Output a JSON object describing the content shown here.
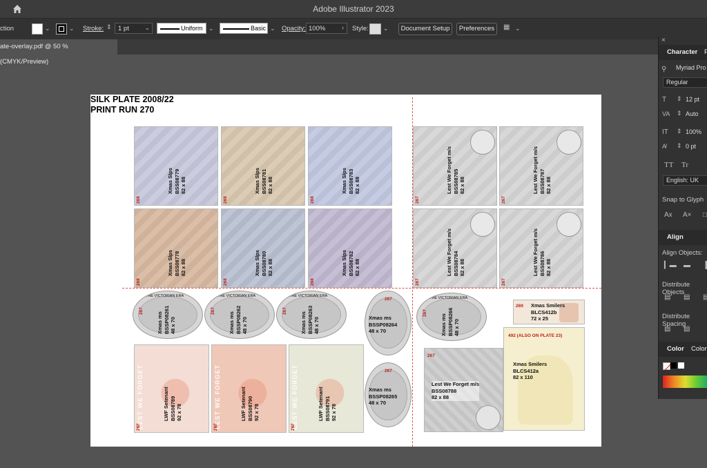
{
  "app": {
    "title": "Adobe Illustrator 2023"
  },
  "controlbar": {
    "selection_label": "ction",
    "stroke_label": "Stroke:",
    "stroke_value": "1 pt",
    "uniform_label": "Uniform",
    "basic_label": "Basic",
    "opacity_label": "Opacity:",
    "opacity_value": "100%",
    "style_label": "Style:",
    "document_setup": "Document Setup",
    "preferences": "Preferences"
  },
  "document_tab": {
    "label": "ate-overlay.pdf @ 50 % (CMYK/Preview)"
  },
  "artboard": {
    "title_line1": "SILK PLATE 2008/22",
    "title_line2": "PRINT RUN 270",
    "xmas_slips": [
      {
        "line1": "Xmas Slps",
        "line2": "BSS08779",
        "line3": "82 x 88",
        "num": "268"
      },
      {
        "line1": "Xmas Slps",
        "line2": "BSS08781",
        "line3": "82 x 88",
        "num": "268"
      },
      {
        "line1": "Xmas Slps",
        "line2": "BSS08783",
        "line3": "82 x 88",
        "num": "268"
      },
      {
        "line1": "Xmas Slps",
        "line2": "BSS08778",
        "line3": "82 x 88",
        "num": "268"
      },
      {
        "line1": "Xmas Slps",
        "line2": "BSS08780",
        "line3": "82 x 88",
        "num": "268"
      },
      {
        "line1": "Xmas Slps",
        "line2": "BSS08782",
        "line3": "82 x 88",
        "num": "268"
      }
    ],
    "lest_we_forget": [
      {
        "line1": "Lest We Forget m/s",
        "line2": "BSS08785",
        "line3": "82 x 88",
        "num": "267"
      },
      {
        "line1": "Lest We Forget m/s",
        "line2": "BSS08787",
        "line3": "82 x 88",
        "num": "267"
      },
      {
        "line1": "Lest We Forget m/s",
        "line2": "BSS08784",
        "line3": "82 x 88",
        "num": "267"
      },
      {
        "line1": "Lest We Forget m/s",
        "line2": "BSS08786",
        "line3": "82 x 88",
        "num": "267"
      }
    ],
    "ovals": [
      {
        "line1": "Xmas ms",
        "line2": "BSSP08261",
        "line3": "48 x 70",
        "num": "267",
        "caption": "THE VICTORIAN ERA"
      },
      {
        "line1": "Xmas ms",
        "line2": "BSSP08262",
        "line3": "48 x 70",
        "num": "267",
        "caption": "THE VICTORIAN ERA"
      },
      {
        "line1": "Xmas ms",
        "line2": "BSSP08263",
        "line3": "48 x 70",
        "num": "267",
        "caption": "THE VICTORIAN ERA"
      },
      {
        "line1": "Xmas ms",
        "line2": "BSSP08266",
        "line3": "48 x 70",
        "num": "267",
        "caption": "THE VICTORIAN ERA"
      }
    ],
    "upright_ovals": [
      {
        "line1": "Xmas ms",
        "line2": "BSSP08264",
        "line3": "48 x 70",
        "num": "267"
      },
      {
        "line1": "Xmas ms",
        "line2": "BSSP08265",
        "line3": "48 x 70",
        "num": "267"
      }
    ],
    "lwf_setenant": [
      {
        "line1": "LWF Setenant",
        "line2": "BSS08789",
        "line3": "92 x 78",
        "num": "268",
        "banner": "LEST WE FORGET"
      },
      {
        "line1": "LWF Setenant",
        "line2": "BSS08790",
        "line3": "92 x 78",
        "num": "268",
        "banner": "LEST WE FORGET"
      },
      {
        "line1": "LWF Setenant",
        "line2": "BSS08791",
        "line3": "92 x 78",
        "num": "268",
        "banner": "LEST WE FORGET"
      }
    ],
    "lwf_upright": {
      "line1": "Lest We Forget m/s",
      "line2": "BSS08788",
      "line3": "82 x 88",
      "num": "267"
    },
    "smilers_small": {
      "line1": "Xmas Smilers",
      "line2": "BLCS412b",
      "line3": "72 x 25",
      "num": "269"
    },
    "smilers_large": {
      "line1": "Xmas Smilers",
      "line2": "BLCS412a",
      "line3": "82 x 110",
      "num": "492 (ALSO ON PLATE 23)"
    }
  },
  "panel": {
    "character_tab": "Character",
    "para_tab": "P",
    "font_family": "Myriad Pro",
    "font_style": "Regular",
    "font_size": "12 pt",
    "leading": "Auto",
    "vscale": "100%",
    "tracking": "0 pt",
    "language": "English: UK",
    "snap_to_glyph": "Snap to Glyph",
    "align_tab": "Align",
    "align_objects": "Align Objects:",
    "distribute_objects": "Distribute Objects",
    "distribute_spacing": "Distribute Spacing",
    "color_tab": "Color",
    "color_guide_tab": "Color"
  },
  "colors": {
    "accent_red": "#b8221c",
    "guide_red": "#e05050"
  }
}
